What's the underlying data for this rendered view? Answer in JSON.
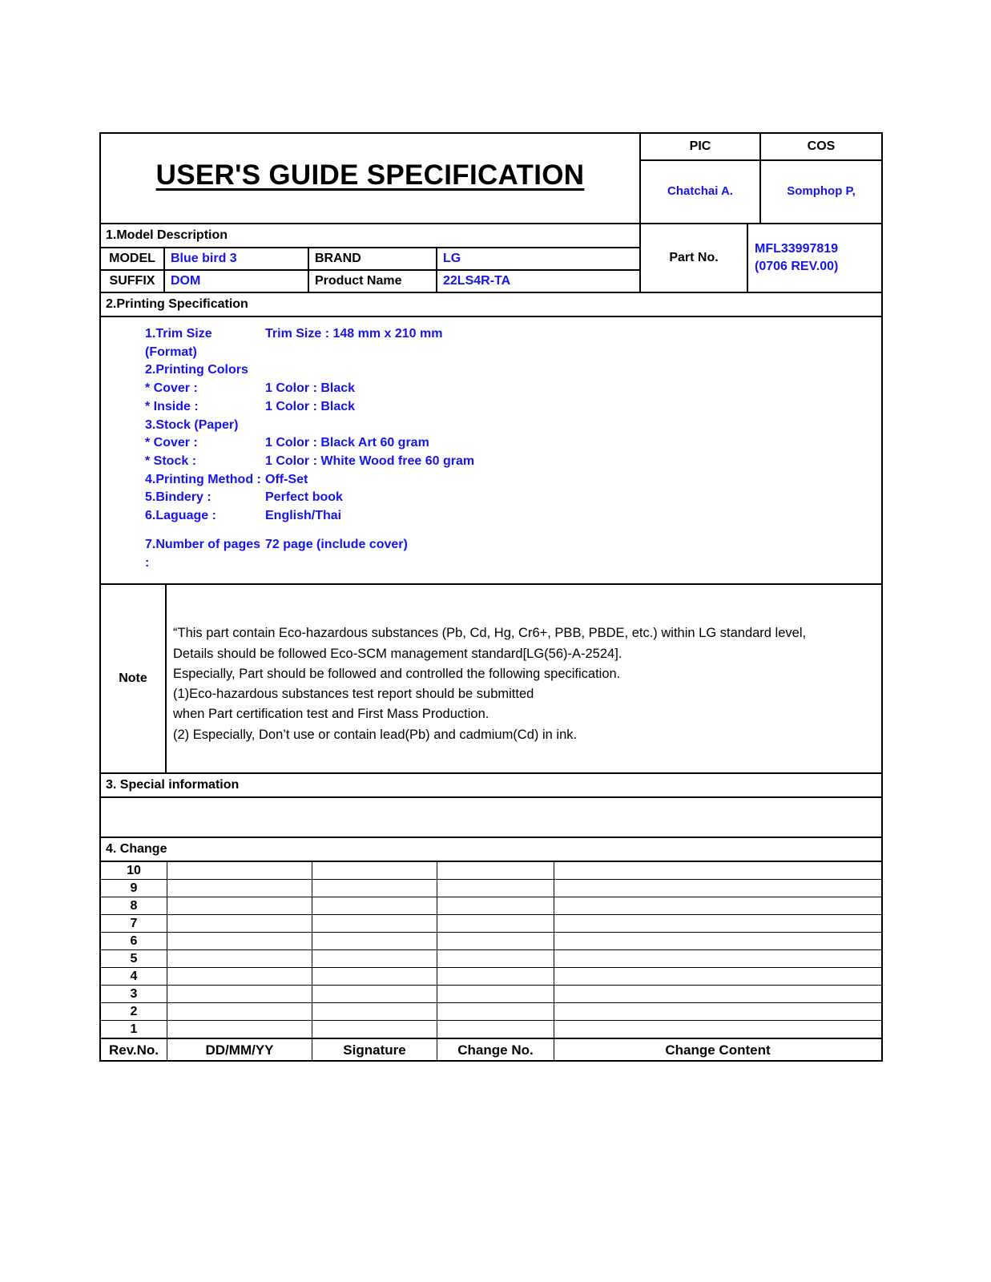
{
  "document": {
    "title": "USER'S GUIDE SPECIFICATION"
  },
  "approval": {
    "pic_header": "PIC",
    "cos_header": "COS",
    "pic_name": "Chatchai A.",
    "cos_name": "Somphop P,"
  },
  "part": {
    "label": "Part No.",
    "number": "MFL33997819",
    "revision": "(0706 REV.00)"
  },
  "model_description": {
    "section_title": "1.Model Description",
    "model_label": "MODEL",
    "model_value": "Blue bird 3",
    "brand_label": "BRAND",
    "brand_value": "LG",
    "suffix_label": "SUFFIX",
    "suffix_value": "DOM",
    "product_name_label": "Product Name",
    "product_name_value": "22LS4R-TA"
  },
  "printing_specification": {
    "section_title": "2.Printing Specification",
    "lines": [
      {
        "key": "1.Trim Size (Format)",
        "value": "Trim Size  : 148 mm x 210 mm"
      },
      {
        "key": "2.Printing Colors",
        "value": ""
      },
      {
        "key": "* Cover :",
        "value": "1 Color : Black"
      },
      {
        "key": "* Inside :",
        "value": "1 Color : Black"
      },
      {
        "key": "3.Stock (Paper)",
        "value": ""
      },
      {
        "key": "* Cover :",
        "value": "1 Color : Black Art 60 gram"
      },
      {
        "key": "* Stock :",
        "value": "1 Color : White Wood free 60 gram"
      },
      {
        "key": "4.Printing Method :",
        "value": "Off-Set"
      },
      {
        "key": "5.Bindery :",
        "value": "Perfect book"
      },
      {
        "key": "6.Laguage :",
        "value": "English/Thai"
      },
      {
        "key": "7.Number of pages :",
        "value": "72 page (include cover)"
      }
    ]
  },
  "note": {
    "label": "Note",
    "lines": [
      "“This part contain Eco-hazardous substances (Pb, Cd, Hg, Cr6+, PBB, PBDE, etc.) within LG standard level,",
      "Details should be followed Eco-SCM management standard[LG(56)-A-2524].",
      "Especially, Part should be followed and controlled the following specification.",
      "(1)Eco-hazardous substances test report should be submitted",
      "when Part certification test and First Mass Production.",
      "(2) Especially, Don’t use or contain lead(Pb) and cadmium(Cd) in ink."
    ]
  },
  "special_information": {
    "section_title": "3. Special information",
    "content": ""
  },
  "change": {
    "section_title": "4. Change",
    "rows": [
      "10",
      "9",
      "8",
      "7",
      "6",
      "5",
      "4",
      "3",
      "2",
      "1"
    ],
    "footer": {
      "rev_no": "Rev.No.",
      "date": "DD/MM/YY",
      "signature": "Signature",
      "change_no": "Change No.",
      "change_content": "Change Content"
    }
  },
  "colors": {
    "ink_blue": "#1414ec",
    "text_black": "#000000",
    "background": "#ffffff"
  }
}
